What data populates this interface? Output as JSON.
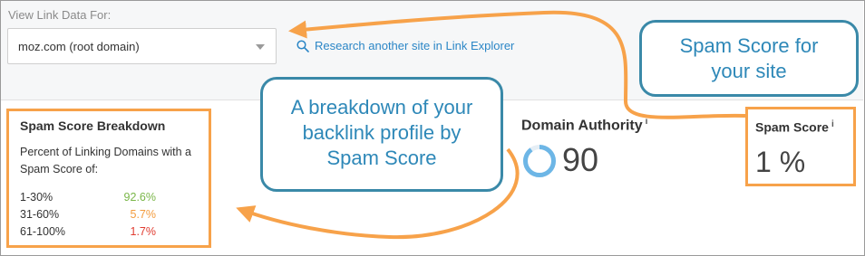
{
  "view_link_data": {
    "label": "View Link Data For:",
    "selected": "moz.com (root domain)"
  },
  "research_link": {
    "label": "Research another site in Link Explorer",
    "icon": "search-icon"
  },
  "spam_breakdown": {
    "title": "Spam Score Breakdown",
    "subtitle": "Percent of Linking Domains with a Spam Score of:",
    "rows": [
      {
        "range": "1-30%",
        "percent": "92.6%",
        "color": "#7ab648"
      },
      {
        "range": "31-60%",
        "percent": "5.7%",
        "color": "#f39c3f"
      },
      {
        "range": "61-100%",
        "percent": "1.7%",
        "color": "#e03c31"
      }
    ]
  },
  "domain_authority": {
    "label": "Domain Authority",
    "info": "i",
    "value": "90",
    "ring_color": "#6db6e6",
    "ring_fraction": 0.9
  },
  "spam_score": {
    "label": "Spam Score",
    "info": "i",
    "value": "1 %"
  },
  "callouts": {
    "spam_site": [
      "Spam Score for",
      "your site"
    ],
    "breakdown": [
      "A breakdown of your",
      "backlink profile by",
      "Spam Score"
    ]
  },
  "colors": {
    "highlight": "#f7a24a",
    "callout_border": "#3a89a8",
    "callout_text": "#2e88b8",
    "link": "#2b86c6"
  }
}
